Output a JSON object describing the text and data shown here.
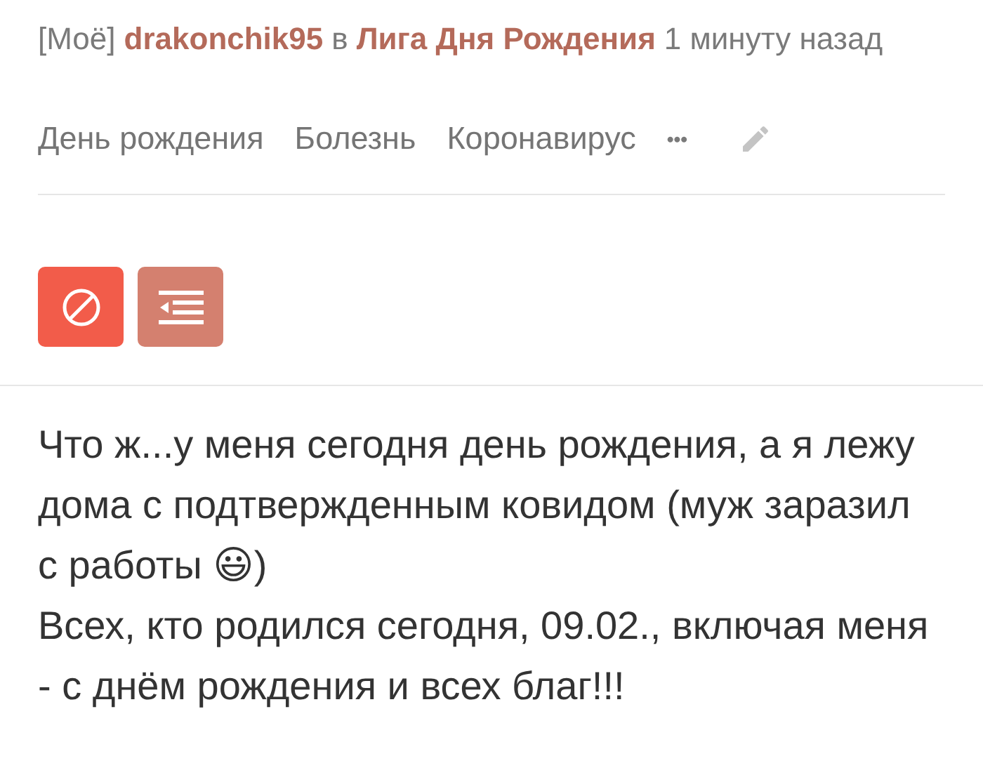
{
  "header": {
    "mine_label": "[Моё]",
    "author": "drakonchik95",
    "preposition": "в",
    "community": "Лига Дня Рождения",
    "time": "1 минуту назад"
  },
  "tags": [
    {
      "label": "День рождения"
    },
    {
      "label": "Болезнь"
    },
    {
      "label": "Коронавирус"
    }
  ],
  "more_tags": "•••",
  "actions": [
    {
      "kind": "block"
    },
    {
      "kind": "outdent"
    }
  ],
  "body": [
    "Что ж...у меня сегодня день рождения, а я лежу дома с подтвержденным ковидом (муж заразил с работы 😃)",
    "Всех, кто родился сегодня, 09.02., включая меня - с днём рождения и всех благ!!!"
  ]
}
